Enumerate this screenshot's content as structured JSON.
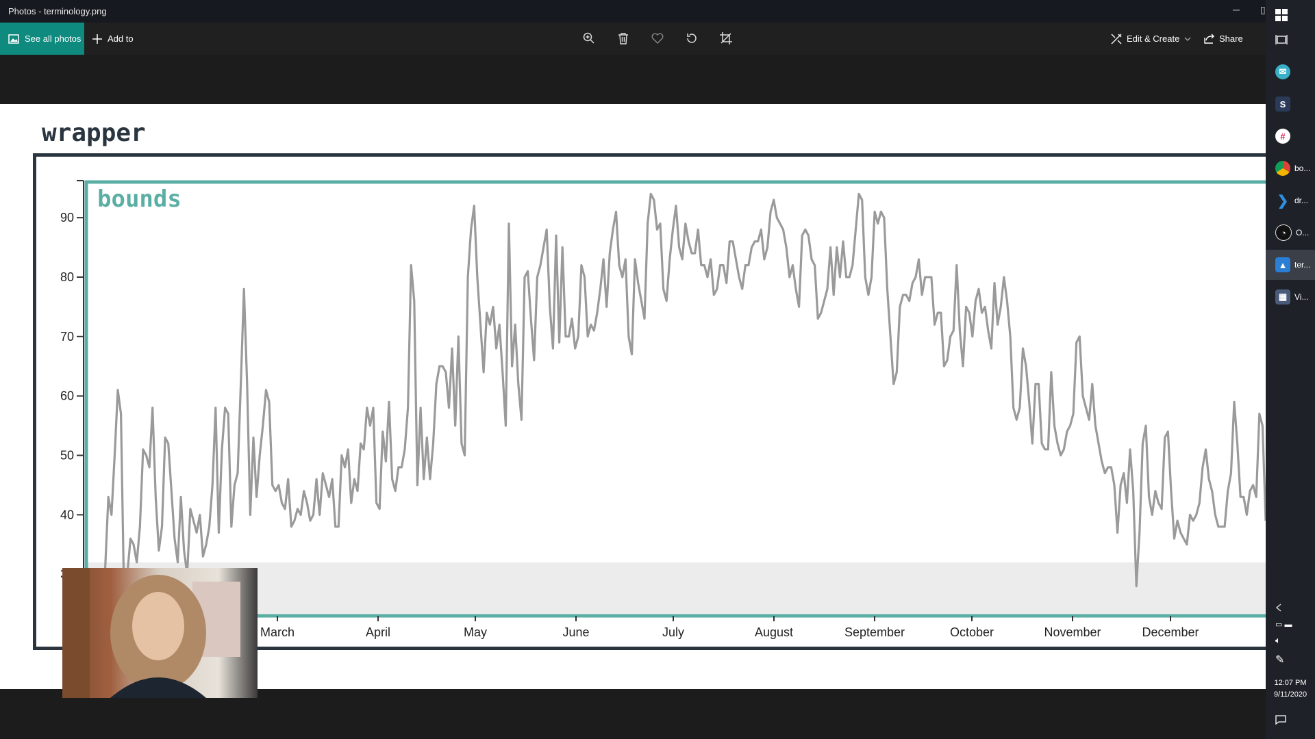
{
  "window": {
    "title": "Photos - terminology.png",
    "minimize": "─",
    "maximize": "▯"
  },
  "toolbar": {
    "see_all": "See all photos",
    "add_to": "Add to",
    "edit_create": "Edit & Create",
    "share": "Share"
  },
  "image": {
    "wrapper_label": "wrapper",
    "bounds_label": "bounds"
  },
  "chart_data": {
    "type": "line",
    "y_ticks": [
      30,
      40,
      50,
      60,
      70,
      80,
      90
    ],
    "ylim": [
      23,
      96
    ],
    "x_ticks": [
      "March",
      "April",
      "May",
      "June",
      "July",
      "August",
      "September",
      "October",
      "November",
      "December"
    ],
    "shaded_below": 32,
    "series": [
      {
        "values": [
          25,
          29,
          27,
          20,
          18,
          25,
          31,
          43,
          40,
          50,
          61,
          57,
          25,
          30,
          36,
          35,
          32,
          38,
          51,
          50,
          48,
          58,
          43,
          34,
          38,
          53,
          52,
          44,
          36,
          32,
          43,
          34,
          30,
          41,
          39,
          37,
          40,
          33,
          35,
          38,
          45,
          58,
          37,
          51,
          58,
          57,
          38,
          45,
          47,
          62,
          78,
          62,
          40,
          53,
          43,
          50,
          55,
          61,
          59,
          45,
          44,
          45,
          42,
          41,
          46,
          38,
          39,
          41,
          40,
          44,
          42,
          39,
          40,
          46,
          40,
          47,
          45,
          43,
          46,
          38,
          38,
          50,
          48,
          51,
          42,
          46,
          44,
          52,
          51,
          58,
          55,
          58,
          42,
          41,
          54,
          49,
          59,
          46,
          44,
          48,
          48,
          51,
          58,
          82,
          76,
          45,
          58,
          46,
          53,
          46,
          52,
          62,
          65,
          65,
          64,
          58,
          68,
          55,
          70,
          52,
          50,
          80,
          88,
          92,
          80,
          72,
          64,
          74,
          72,
          75,
          68,
          72,
          64,
          55,
          89,
          65,
          72,
          62,
          56,
          80,
          81,
          73,
          66,
          80,
          82,
          85,
          88,
          75,
          68,
          87,
          69,
          85,
          70,
          70,
          73,
          68,
          70,
          82,
          80,
          70,
          72,
          71,
          74,
          78,
          83,
          75,
          84,
          88,
          91,
          82,
          80,
          83,
          70,
          67,
          83,
          79,
          76,
          73,
          89,
          94,
          93,
          88,
          89,
          78,
          76,
          83,
          88,
          92,
          85,
          83,
          89,
          86,
          84,
          84,
          88,
          82,
          82,
          80,
          83,
          77,
          78,
          82,
          82,
          79,
          86,
          86,
          83,
          80,
          78,
          82,
          82,
          85,
          86,
          86,
          88,
          83,
          85,
          91,
          93,
          90,
          89,
          88,
          85,
          80,
          82,
          78,
          75,
          87,
          88,
          87,
          83,
          82,
          73,
          74,
          76,
          78,
          85,
          77,
          85,
          80,
          86,
          80,
          80,
          82,
          88,
          94,
          93,
          80,
          77,
          80,
          91,
          89,
          91,
          90,
          78,
          70,
          62,
          64,
          75,
          77,
          77,
          76,
          79,
          80,
          83,
          77,
          80,
          80,
          80,
          72,
          74,
          74,
          65,
          66,
          70,
          71,
          82,
          71,
          65,
          75,
          74,
          70,
          76,
          78,
          74,
          75,
          71,
          68,
          79,
          72,
          75,
          80,
          76,
          70,
          58,
          56,
          58,
          68,
          65,
          59,
          52,
          62,
          62,
          52,
          51,
          51,
          64,
          55,
          52,
          50,
          51,
          54,
          55,
          57,
          69,
          70,
          60,
          58,
          56,
          62,
          55,
          52,
          49,
          47,
          48,
          48,
          45,
          37,
          45,
          47,
          42,
          51,
          44,
          28,
          37,
          52,
          55,
          43,
          40,
          44,
          42,
          41,
          53,
          54,
          44,
          36,
          39,
          37,
          36,
          35,
          40,
          39,
          40,
          42,
          48,
          51,
          46,
          44,
          40,
          38,
          38,
          38,
          44,
          47,
          59,
          52,
          43,
          43,
          40,
          44,
          45,
          43,
          57,
          55,
          39
        ]
      }
    ]
  },
  "taskbar": {
    "items": [
      {
        "label": "bo..."
      },
      {
        "label": "dr..."
      },
      {
        "label": "O..."
      },
      {
        "label": "ter..."
      },
      {
        "label": "Vi..."
      }
    ],
    "time": "12:07 PM",
    "date": "9/11/2020"
  },
  "colors": {
    "accent": "#0e8a7e",
    "bounds": "#5aaea4",
    "wrapper": "#2a3540",
    "line": "#9a9a9a",
    "shade": "#ececec"
  }
}
